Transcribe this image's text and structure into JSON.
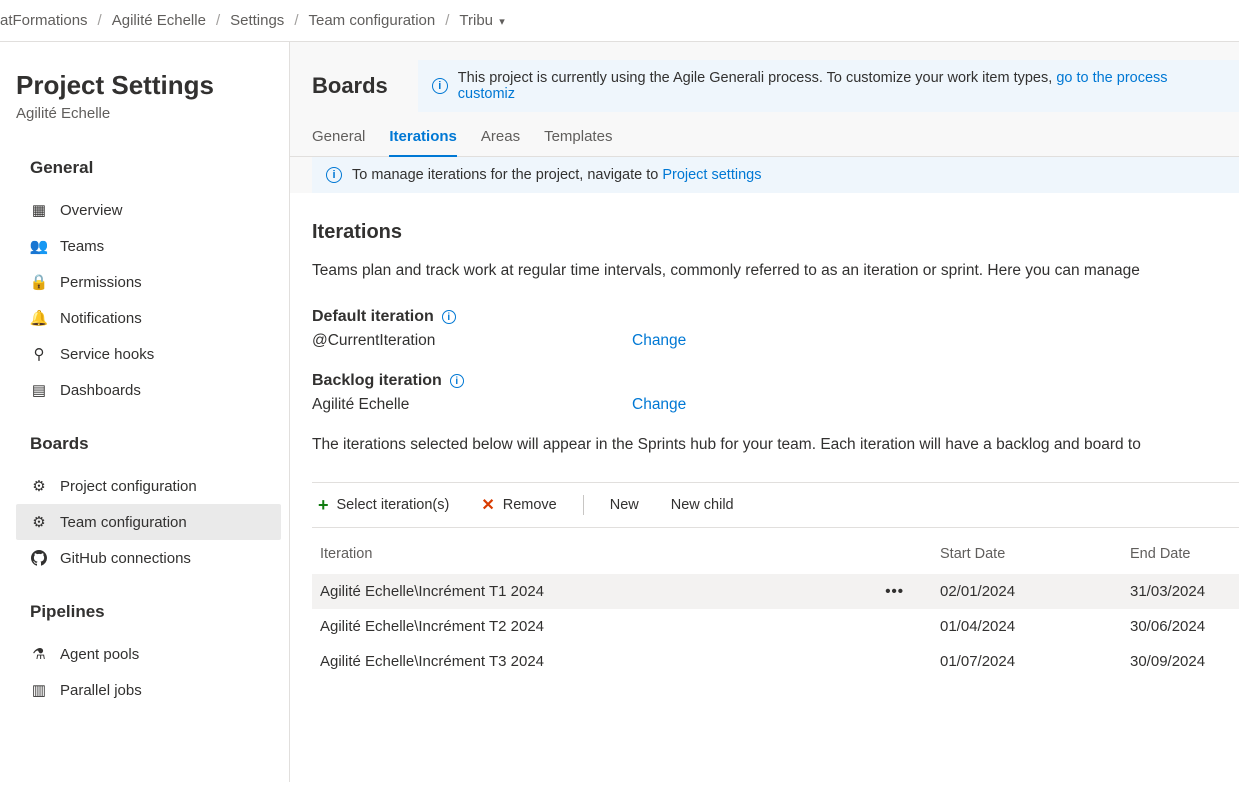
{
  "breadcrumb": {
    "items": [
      "atFormations",
      "Agilité Echelle",
      "Settings",
      "Team configuration",
      "Tribu"
    ],
    "sep": "/"
  },
  "sidebar": {
    "title": "Project Settings",
    "subtitle": "Agilité Echelle",
    "groups": [
      {
        "title": "General",
        "items": [
          {
            "label": "Overview"
          },
          {
            "label": "Teams"
          },
          {
            "label": "Permissions"
          },
          {
            "label": "Notifications"
          },
          {
            "label": "Service hooks"
          },
          {
            "label": "Dashboards"
          }
        ]
      },
      {
        "title": "Boards",
        "items": [
          {
            "label": "Project configuration"
          },
          {
            "label": "Team configuration"
          },
          {
            "label": "GitHub connections"
          }
        ]
      },
      {
        "title": "Pipelines",
        "items": [
          {
            "label": "Agent pools"
          },
          {
            "label": "Parallel jobs"
          }
        ]
      }
    ]
  },
  "main": {
    "header": "Boards",
    "process_banner": {
      "text": "This project is currently using the Agile Generali process. To customize your work item types, ",
      "link": "go to the process customiz"
    },
    "tabs": [
      "General",
      "Iterations",
      "Areas",
      "Templates"
    ],
    "active_tab": "Iterations",
    "manage_banner": {
      "text": "To manage iterations for the project, navigate to ",
      "link": "Project settings"
    },
    "section_title": "Iterations",
    "section_desc": "Teams plan and track work at regular time intervals, commonly referred to as an iteration or sprint. Here you can manage",
    "default_iteration": {
      "label": "Default iteration",
      "value": "@CurrentIteration",
      "change": "Change"
    },
    "backlog_iteration": {
      "label": "Backlog iteration",
      "value": "Agilité Echelle",
      "change": "Change"
    },
    "sprints_desc": "The iterations selected below will appear in the Sprints hub for your team. Each iteration will have a backlog and board to",
    "toolbar": {
      "select": "Select iteration(s)",
      "remove": "Remove",
      "new": "New",
      "new_child": "New child"
    },
    "table": {
      "cols": [
        "Iteration",
        "Start Date",
        "End Date"
      ],
      "rows": [
        {
          "name": "Agilité Echelle\\Incrément T1 2024",
          "start": "02/01/2024",
          "end": "31/03/2024",
          "hover": true
        },
        {
          "name": "Agilité Echelle\\Incrément T2 2024",
          "start": "01/04/2024",
          "end": "30/06/2024"
        },
        {
          "name": "Agilité Echelle\\Incrément T3 2024",
          "start": "01/07/2024",
          "end": "30/09/2024"
        }
      ]
    }
  }
}
